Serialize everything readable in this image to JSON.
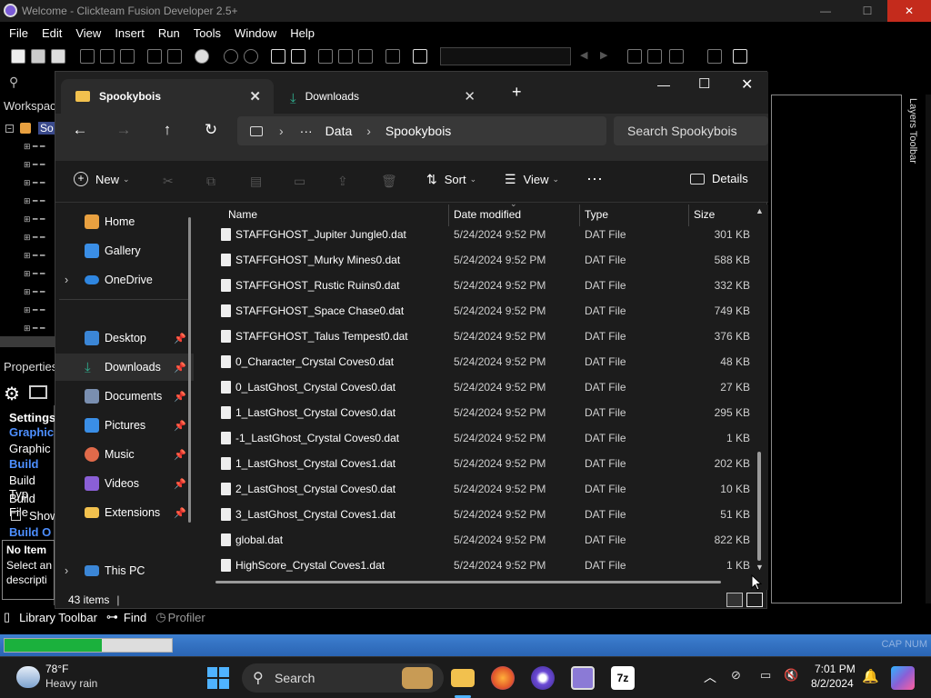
{
  "fusion": {
    "title": "Welcome - Clickteam Fusion Developer 2.5+",
    "menu": [
      "File",
      "Edit",
      "View",
      "Insert",
      "Run",
      "Tools",
      "Window",
      "Help"
    ],
    "workspace_label": "Workspac",
    "tree_root_label": "So",
    "properties_label": "Properties",
    "left_items": [
      "Settings",
      "Graphic",
      "Graphic",
      "Build",
      "Build Typ",
      "Build File",
      "Show",
      "Build O",
      "No Item",
      "Select an",
      "descripti"
    ],
    "layers_toolbar": "Layers Toolbar",
    "bottom_tabs": [
      "Library Toolbar",
      "Find",
      "Profiler"
    ],
    "status_right": "CAP NUM",
    "progress": 0.58
  },
  "explorer": {
    "tabs": [
      {
        "label": "Spookybois"
      },
      {
        "label": "Downloads"
      }
    ],
    "new_tab": "+",
    "window_controls": {
      "minimize": "—",
      "maximize": "☐",
      "close": "✕"
    },
    "breadcrumb": {
      "more": "···",
      "items": [
        "Data",
        "Spookybois"
      ]
    },
    "search_placeholder": "Search Spookybois",
    "commands": {
      "new": "New",
      "sort": "Sort",
      "view": "View",
      "more": "···",
      "details": "Details"
    },
    "nav": [
      {
        "label": "Home",
        "icon": "home-icon",
        "color": "#e8a040",
        "pinned": false,
        "indent": false
      },
      {
        "label": "Gallery",
        "icon": "gallery-icon",
        "color": "#3a8ee6",
        "pinned": false,
        "indent": false
      },
      {
        "label": "OneDrive",
        "icon": "cloud-icon",
        "color": "#2f86e0",
        "pinned": false,
        "indent": false,
        "expand": true
      },
      {
        "label": "Desktop",
        "icon": "desktop-icon",
        "color": "#3b86d6",
        "pinned": true,
        "indent": true
      },
      {
        "label": "Downloads",
        "icon": "download-icon",
        "color": "#2fae8f",
        "pinned": true,
        "indent": true,
        "selected": true
      },
      {
        "label": "Documents",
        "icon": "documents-icon",
        "color": "#7a8fb0",
        "pinned": true,
        "indent": true
      },
      {
        "label": "Pictures",
        "icon": "pictures-icon",
        "color": "#3a8ee6",
        "pinned": true,
        "indent": true
      },
      {
        "label": "Music",
        "icon": "music-icon",
        "color": "#e06a4a",
        "pinned": true,
        "indent": true
      },
      {
        "label": "Videos",
        "icon": "videos-icon",
        "color": "#8a5fd6",
        "pinned": true,
        "indent": true
      },
      {
        "label": "Extensions",
        "icon": "folder-icon",
        "color": "#f2c14e",
        "pinned": true,
        "indent": true
      },
      {
        "label": "This PC",
        "icon": "pc-icon",
        "color": "#3b86d6",
        "pinned": false,
        "indent": false,
        "expand": true
      }
    ],
    "columns": {
      "name": "Name",
      "date": "Date modified",
      "type": "Type",
      "size": "Size"
    },
    "files": [
      {
        "name": "STAFFGHOST_Jupiter Jungle0.dat",
        "date": "5/24/2024 9:52 PM",
        "type": "DAT File",
        "size": "301 KB"
      },
      {
        "name": "STAFFGHOST_Murky Mines0.dat",
        "date": "5/24/2024 9:52 PM",
        "type": "DAT File",
        "size": "588 KB"
      },
      {
        "name": "STAFFGHOST_Rustic Ruins0.dat",
        "date": "5/24/2024 9:52 PM",
        "type": "DAT File",
        "size": "332 KB"
      },
      {
        "name": "STAFFGHOST_Space Chase0.dat",
        "date": "5/24/2024 9:52 PM",
        "type": "DAT File",
        "size": "749 KB"
      },
      {
        "name": "STAFFGHOST_Talus Tempest0.dat",
        "date": "5/24/2024 9:52 PM",
        "type": "DAT File",
        "size": "376 KB"
      },
      {
        "name": "0_Character_Crystal Coves0.dat",
        "date": "5/24/2024 9:52 PM",
        "type": "DAT File",
        "size": "48 KB"
      },
      {
        "name": "0_LastGhost_Crystal Coves0.dat",
        "date": "5/24/2024 9:52 PM",
        "type": "DAT File",
        "size": "27 KB"
      },
      {
        "name": "1_LastGhost_Crystal Coves0.dat",
        "date": "5/24/2024 9:52 PM",
        "type": "DAT File",
        "size": "295 KB"
      },
      {
        "name": "-1_LastGhost_Crystal Coves0.dat",
        "date": "5/24/2024 9:52 PM",
        "type": "DAT File",
        "size": "1 KB"
      },
      {
        "name": "1_LastGhost_Crystal Coves1.dat",
        "date": "5/24/2024 9:52 PM",
        "type": "DAT File",
        "size": "202 KB"
      },
      {
        "name": "2_LastGhost_Crystal Coves0.dat",
        "date": "5/24/2024 9:52 PM",
        "type": "DAT File",
        "size": "10 KB"
      },
      {
        "name": "3_LastGhost_Crystal Coves1.dat",
        "date": "5/24/2024 9:52 PM",
        "type": "DAT File",
        "size": "51 KB"
      },
      {
        "name": "global.dat",
        "date": "5/24/2024 9:52 PM",
        "type": "DAT File",
        "size": "822 KB"
      },
      {
        "name": "HighScore_Crystal Coves1.dat",
        "date": "5/24/2024 9:52 PM",
        "type": "DAT File",
        "size": "1 KB"
      }
    ],
    "item_count": "43 items"
  },
  "taskbar": {
    "weather_temp": "78°F",
    "weather_desc": "Heavy rain",
    "search": "Search",
    "time": "7:01 PM",
    "date": "8/2/2024"
  }
}
